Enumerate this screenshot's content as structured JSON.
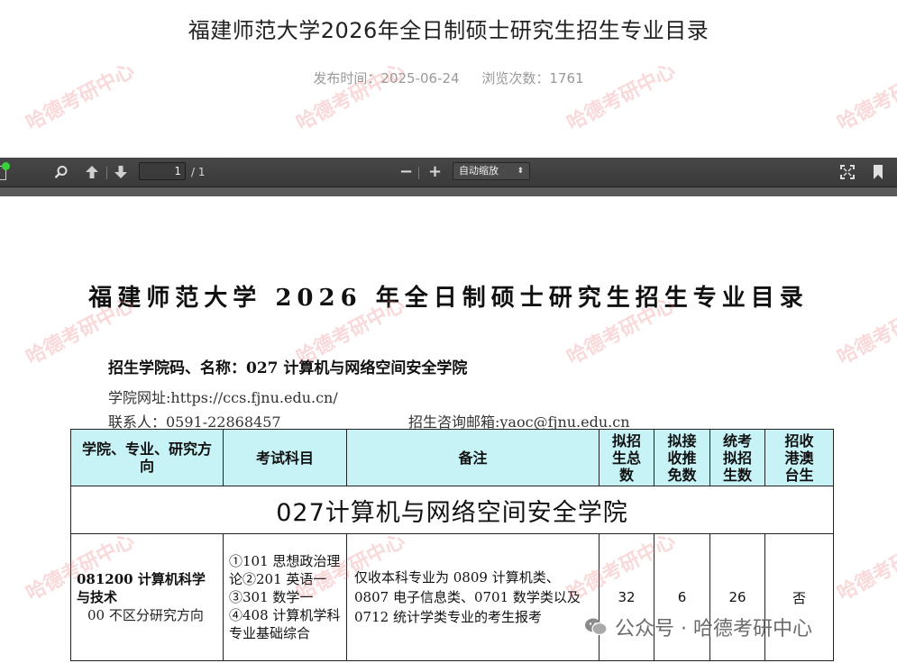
{
  "article": {
    "title": "福建师范大学2026年全日制硕士研究生招生专业目录",
    "publish_label": "发布时间：2025-06-24",
    "views_label": "浏览次数：1761"
  },
  "viewer": {
    "page_current": "1",
    "page_total": "/ 1",
    "zoom_minus": "−",
    "zoom_plus": "+",
    "zoom_value": "自动缩放",
    "zoom_caret": "⬍",
    "icons": [
      "sidebar-icon",
      "search-icon",
      "arrow-up-icon",
      "arrow-down-icon",
      "zoom-out-icon",
      "zoom-in-icon",
      "fullscreen-icon",
      "bookmark-icon"
    ]
  },
  "document": {
    "title": "福建师范大学 2026 年全日制硕士研究生招生专业目录",
    "college_line": "招生学院码、名称：027 计算机与网络空间安全学院",
    "website_line": "学院网址:https://ccs.fjnu.edu.cn/",
    "contact_line": "联系人：0591-22868457",
    "email_line": "招生咨询邮箱:yaoc@fjnu.edu.cn",
    "table": {
      "headers": [
        "学院、专业、研究方向",
        "考试科目",
        "备注",
        "拟招生总数",
        "拟接收推免数",
        "统考拟招生数",
        "招收港澳台生"
      ],
      "section_title": "027计算机与网络空间安全学院",
      "rows": [
        {
          "major": "081200 计算机科学与技术",
          "direction": "00 不区分研究方向",
          "exam": "①101 思想政治理论②201 英语一③301 数学一④408 计算机学科专业基础综合",
          "note": "仅收本科专业为 0809 计算机类、0807 电子信息类、0701 数学类以及 0712 统计学类专业的考生报考",
          "total": "32",
          "exempt": "6",
          "unified": "26",
          "hk_macao_tw": "否"
        }
      ]
    }
  },
  "watermark": {
    "text": "哈德考研中心"
  },
  "wechat": {
    "label": "公众号 · 哈德考研中心"
  }
}
